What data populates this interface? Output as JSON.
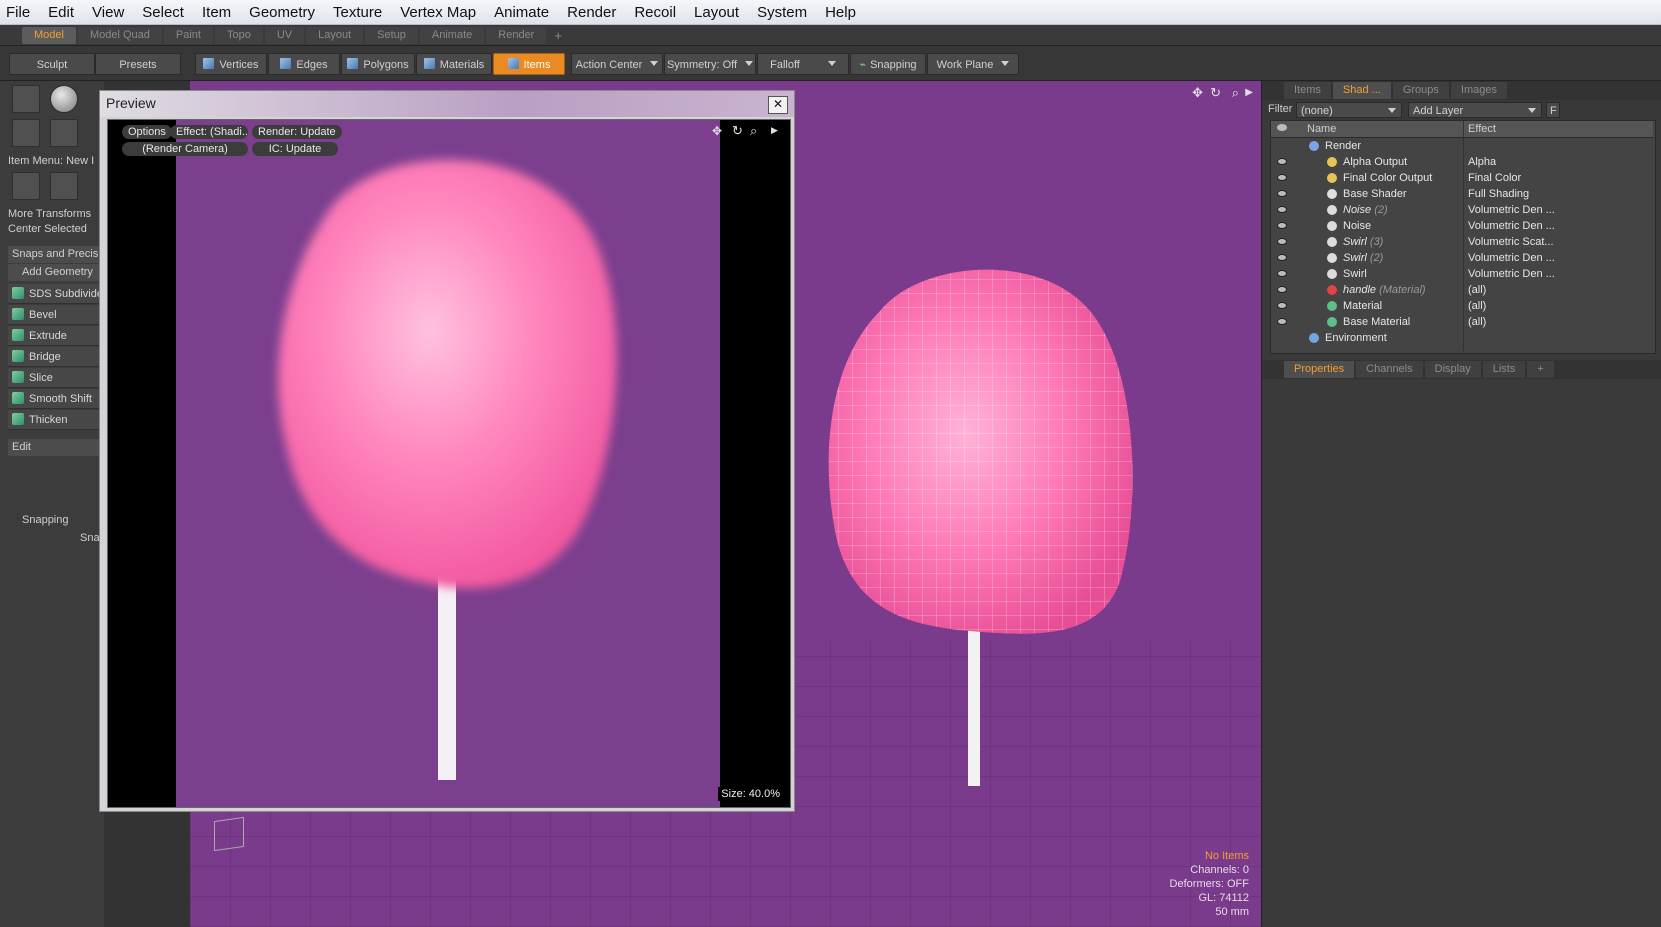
{
  "menu": [
    "File",
    "Edit",
    "View",
    "Select",
    "Item",
    "Geometry",
    "Texture",
    "Vertex Map",
    "Animate",
    "Render",
    "Recoil",
    "Layout",
    "System",
    "Help"
  ],
  "mode_tabs": {
    "items": [
      "Model",
      "Model Quad",
      "Paint",
      "Topo",
      "UV",
      "Layout",
      "Setup",
      "Animate",
      "Render"
    ],
    "active": "Model",
    "add": "+"
  },
  "toolbar": {
    "sculpt": "Sculpt",
    "presets": "Presets",
    "vertices": "Vertices",
    "edges": "Edges",
    "polygons": "Polygons",
    "materials": "Materials",
    "items": "Items",
    "action_center": "Action Center",
    "symmetry": "Symmetry: Off",
    "falloff": "Falloff",
    "snapping": "Snapping",
    "work_plane": "Work Plane"
  },
  "left_panel": {
    "item_menu": "Item Menu: New I",
    "more_transforms": "More Transforms",
    "center_selected": "Center Selected",
    "snaps_precision": "Snaps and Precisio",
    "add_geometry": "Add Geometry",
    "tools": [
      "SDS Subdivide",
      "Bevel",
      "Extrude",
      "Bridge",
      "Slice",
      "Smooth Shift",
      "Thicken"
    ],
    "edit": "Edit",
    "snapping": "Snapping",
    "snap_short": "Sna"
  },
  "preview": {
    "title": "Preview",
    "close": "✕",
    "options": "Options",
    "effect": "Effect: (Shadi...",
    "render_update": "Render: Update",
    "render_camera": "(Render Camera)",
    "ic_update": "IC: Update",
    "size": "Size: 40.0%"
  },
  "viewport_stats": {
    "no_items": "No Items",
    "channels": "Channels: 0",
    "deformers": "Deformers: OFF",
    "gl": "GL: 74112",
    "scale": "50 mm"
  },
  "right_panel": {
    "tabs": [
      "Items",
      "Shad ...",
      "Groups",
      "Images"
    ],
    "active_tab": "Shad ...",
    "filter_label": "Filter",
    "filter_value": "(none)",
    "add_layer": "Add Layer",
    "f_button": "F",
    "col_name": "Name",
    "col_effect": "Effect",
    "rows": [
      {
        "name": "Render",
        "suffix": "",
        "effect": "",
        "indent": 0,
        "icon": "render-icon"
      },
      {
        "name": "Alpha Output",
        "suffix": "",
        "effect": "Alpha",
        "indent": 1,
        "icon": "output-icon"
      },
      {
        "name": "Final Color Output",
        "suffix": "",
        "effect": "Final Color",
        "indent": 1,
        "icon": "output-icon"
      },
      {
        "name": "Base Shader",
        "suffix": "",
        "effect": "Full Shading",
        "indent": 1,
        "icon": "shader-icon"
      },
      {
        "name": "Noise",
        "suffix": "(2)",
        "effect": "Volumetric Den ...",
        "indent": 1,
        "icon": "texture-icon"
      },
      {
        "name": "Noise",
        "suffix": "",
        "effect": "Volumetric Den ...",
        "indent": 1,
        "icon": "texture-icon"
      },
      {
        "name": "Swirl",
        "suffix": "(3)",
        "effect": "Volumetric Scat...",
        "indent": 1,
        "icon": "texture-icon"
      },
      {
        "name": "Swirl",
        "suffix": "(2)",
        "effect": "Volumetric Den ...",
        "indent": 1,
        "icon": "texture-icon"
      },
      {
        "name": "Swirl",
        "suffix": "",
        "effect": "Volumetric Den ...",
        "indent": 1,
        "icon": "texture-icon"
      },
      {
        "name": "handle",
        "suffix": "(Material)",
        "effect": "(all)",
        "indent": 1,
        "icon": "mask-icon"
      },
      {
        "name": "Material",
        "suffix": "",
        "effect": "(all)",
        "indent": 1,
        "icon": "material-icon"
      },
      {
        "name": "Base Material",
        "suffix": "",
        "effect": "(all)",
        "indent": 1,
        "icon": "material-icon"
      },
      {
        "name": "Environment",
        "suffix": "",
        "effect": "",
        "indent": 0,
        "icon": "environment-icon"
      }
    ],
    "bottom_tabs": [
      "Properties",
      "Channels",
      "Display",
      "Lists"
    ],
    "bottom_active": "Properties",
    "bottom_add": "+"
  },
  "colors": {
    "accent": "#f0a030",
    "viewport_bg": "#7a3b8c",
    "cotton_candy": "#ff6fae"
  }
}
